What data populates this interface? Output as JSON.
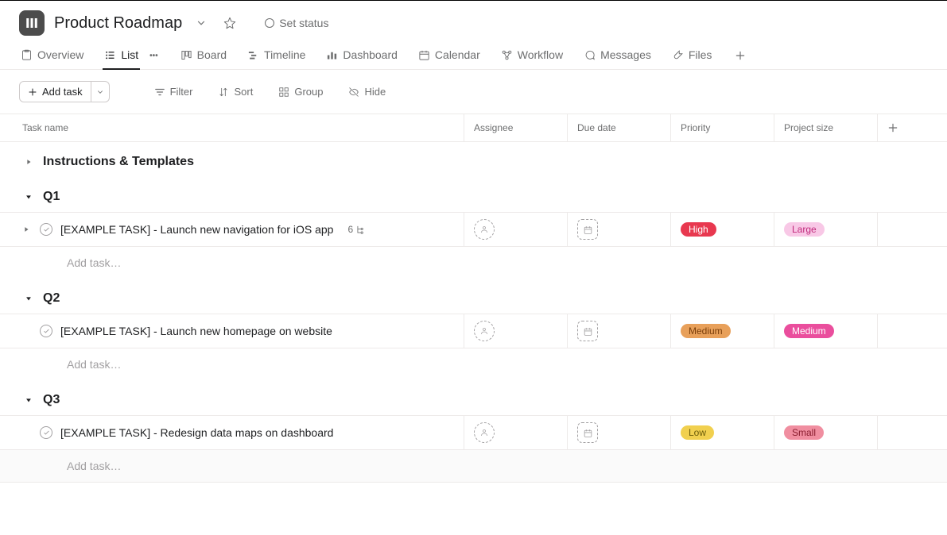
{
  "header": {
    "title": "Product Roadmap",
    "set_status_label": "Set status"
  },
  "tabs": [
    {
      "id": "overview",
      "label": "Overview"
    },
    {
      "id": "list",
      "label": "List"
    },
    {
      "id": "board",
      "label": "Board"
    },
    {
      "id": "timeline",
      "label": "Timeline"
    },
    {
      "id": "dashboard",
      "label": "Dashboard"
    },
    {
      "id": "calendar",
      "label": "Calendar"
    },
    {
      "id": "workflow",
      "label": "Workflow"
    },
    {
      "id": "messages",
      "label": "Messages"
    },
    {
      "id": "files",
      "label": "Files"
    }
  ],
  "active_tab_index": 1,
  "toolbar": {
    "add_task": "Add task",
    "filter": "Filter",
    "sort": "Sort",
    "group": "Group",
    "hide": "Hide"
  },
  "columns": {
    "task": "Task name",
    "assignee": "Assignee",
    "due": "Due date",
    "priority": "Priority",
    "size": "Project size"
  },
  "add_task_placeholder": "Add task…",
  "sections": [
    {
      "title": "Instructions & Templates",
      "collapsed": true,
      "tasks": []
    },
    {
      "title": "Q1",
      "collapsed": false,
      "tasks": [
        {
          "name": "[EXAMPLE TASK] - Launch new navigation for iOS app",
          "has_subtasks": true,
          "subtask_count": 6,
          "priority": {
            "label": "High",
            "bg": "#e8384f",
            "fg": "#ffffff"
          },
          "size": {
            "label": "Large",
            "bg": "#f8c8e6",
            "fg": "#c12a7c"
          }
        }
      ]
    },
    {
      "title": "Q2",
      "collapsed": false,
      "tasks": [
        {
          "name": "[EXAMPLE TASK] - Launch new homepage on website",
          "has_subtasks": false,
          "priority": {
            "label": "Medium",
            "bg": "#e8a05a",
            "fg": "#7a3e0a"
          },
          "size": {
            "label": "Medium",
            "bg": "#ea4e9d",
            "fg": "#ffffff"
          }
        }
      ]
    },
    {
      "title": "Q3",
      "collapsed": false,
      "tasks": [
        {
          "name": "[EXAMPLE TASK] - Redesign data maps on dashboard",
          "has_subtasks": false,
          "priority": {
            "label": "Low",
            "bg": "#f1d04f",
            "fg": "#6b5c0a"
          },
          "size": {
            "label": "Small",
            "bg": "#f08ea0",
            "fg": "#8a1d2f"
          }
        }
      ]
    }
  ]
}
